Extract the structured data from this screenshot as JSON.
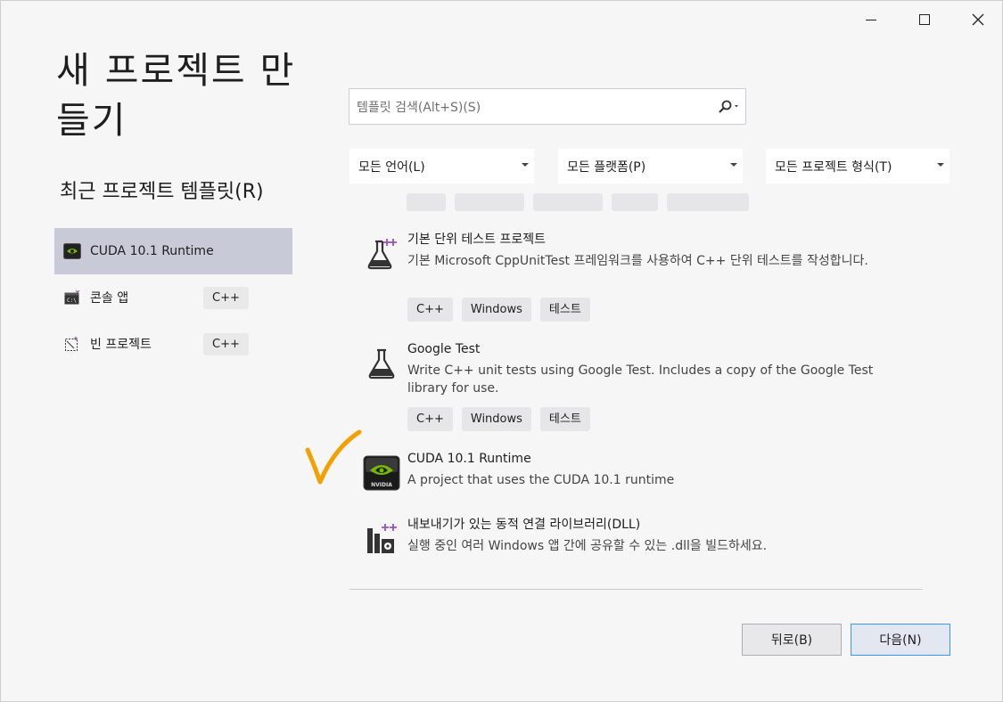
{
  "window": {
    "minimize_label": "",
    "maximize_label": "",
    "close_label": ""
  },
  "page": {
    "title": "새 프로젝트 만들기",
    "recent_title": "최근 프로젝트 템플릿(R)"
  },
  "recent_templates": [
    {
      "name": "CUDA 10.1 Runtime",
      "lang": "",
      "icon": "nvidia-icon"
    },
    {
      "name": "콘솔 앱",
      "lang": "C++",
      "icon": "console-app-icon"
    },
    {
      "name": "빈 프로젝트",
      "lang": "C++",
      "icon": "empty-project-icon"
    }
  ],
  "search": {
    "placeholder": "템플릿 검색(Alt+S)(S)"
  },
  "filters": {
    "language": "모든 언어(L)",
    "platform": "모든 플랫폼(P)",
    "project_type": "모든 프로젝트 형식(T)"
  },
  "templates": [
    {
      "name": "기본 단위 테스트 프로젝트",
      "description": "기본 Microsoft CppUnitTest 프레임워크를 사용하여 C++ 단위 테스트를 작성합니다.",
      "tags": [
        "C++",
        "Windows",
        "테스트"
      ],
      "icon": "unit-test-flask-icon"
    },
    {
      "name": "Google Test",
      "description": "Write C++ unit tests using Google Test. Includes a copy of the Google Test library for use.",
      "tags": [
        "C++",
        "Windows",
        "테스트"
      ],
      "icon": "flask-icon"
    },
    {
      "name": "CUDA 10.1 Runtime",
      "description": "A project that uses the CUDA 10.1 runtime",
      "tags": [],
      "icon": "nvidia-icon"
    },
    {
      "name": "내보내기가 있는 동적 연결 라이브러리(DLL)",
      "description": "실행 중인 여러 Windows 앱 간에 공유할 수 있는 .dll을 빌드하세요.",
      "tags": [],
      "icon": "dll-icon"
    }
  ],
  "buttons": {
    "back": "뒤로(B)",
    "next": "다음(N)"
  },
  "colors": {
    "selected_bg": "#c9cad8",
    "accent_border": "#3399ff",
    "checkmark": "#f2a100",
    "nvidia_green": "#76b900"
  }
}
